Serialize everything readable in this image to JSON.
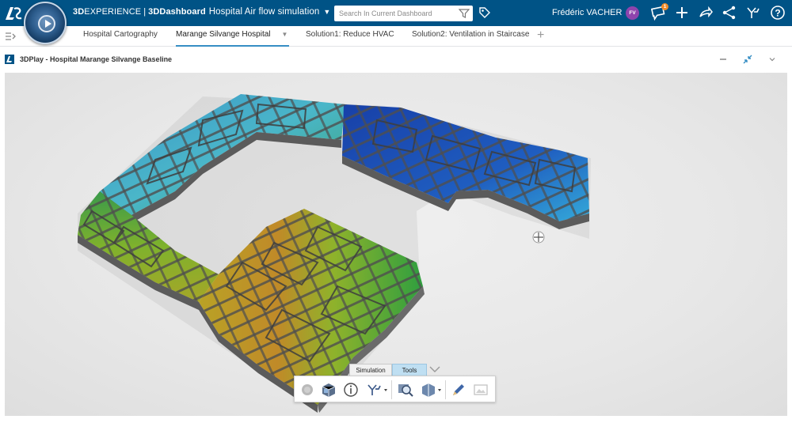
{
  "header": {
    "brand_bold": "3D",
    "brand_rest": "EXPERIENCE",
    "separator": "|",
    "app_bold": "3DDashboard",
    "dashboard_title": "Hospital Air flow simulation",
    "search_placeholder": "Search In Current Dashboard",
    "user_name": "Frédéric VACHER",
    "user_initials": "FV",
    "notification_count": "1",
    "accent": "#005386"
  },
  "tabs": [
    {
      "label": "Hospital Cartography"
    },
    {
      "label": "Marange Silvange Hospital",
      "active": true
    },
    {
      "label": "Solution1: Reduce HVAC"
    },
    {
      "label": "Solution2: Ventilation in Staircase"
    }
  ],
  "widget": {
    "title": "3DPlay - Hospital Marange Silvange Baseline"
  },
  "toolbar": {
    "tabs": [
      {
        "label": "Simulation"
      },
      {
        "label": "Tools",
        "active": true
      }
    ],
    "icons": [
      "record-icon",
      "3d-box-icon",
      "info-icon",
      "fork-icon",
      "zoom-icon",
      "section-icon",
      "pencil-icon",
      "image-icon"
    ]
  },
  "colors": {
    "topbar": "#005386",
    "active_tab": "#368ec4",
    "tools_tab": "#bfdff2"
  }
}
